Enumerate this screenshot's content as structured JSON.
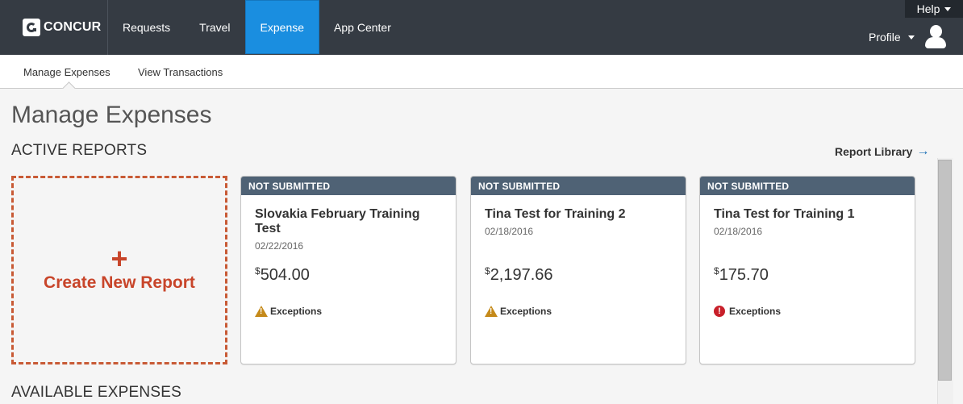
{
  "app": {
    "logo_text": "CONCUR"
  },
  "topnav": {
    "items": [
      {
        "label": "Requests",
        "active": false
      },
      {
        "label": "Travel",
        "active": false
      },
      {
        "label": "Expense",
        "active": true
      },
      {
        "label": "App Center",
        "active": false
      }
    ],
    "help_label": "Help",
    "profile_label": "Profile"
  },
  "subnav": {
    "items": [
      {
        "label": "Manage Expenses",
        "active": true
      },
      {
        "label": "View Transactions",
        "active": false
      }
    ]
  },
  "page": {
    "title": "Manage Expenses",
    "active_reports_title": "ACTIVE REPORTS",
    "report_library_label": "Report Library",
    "available_expenses_title": "AVAILABLE EXPENSES"
  },
  "create_report": {
    "icon": "+",
    "label": "Create New Report"
  },
  "reports": [
    {
      "status": "NOT SUBMITTED",
      "title": "Slovakia February Training Test",
      "date": "02/22/2016",
      "currency": "$",
      "amount": "504.00",
      "exceptions_label": "Exceptions",
      "exception_type": "warning"
    },
    {
      "status": "NOT SUBMITTED",
      "title": "Tina Test for Training 2",
      "date": "02/18/2016",
      "currency": "$",
      "amount": "2,197.66",
      "exceptions_label": "Exceptions",
      "exception_type": "warning"
    },
    {
      "status": "NOT SUBMITTED",
      "title": "Tina Test for Training 1",
      "date": "02/18/2016",
      "currency": "$",
      "amount": "175.70",
      "exceptions_label": "Exceptions",
      "exception_type": "error"
    }
  ],
  "colors": {
    "topbar": "#353b43",
    "active_nav": "#1a8ee0",
    "status_bar": "#4f6275",
    "create_accent": "#c8452a",
    "warning": "#c58a1a",
    "error": "#c8202a"
  }
}
